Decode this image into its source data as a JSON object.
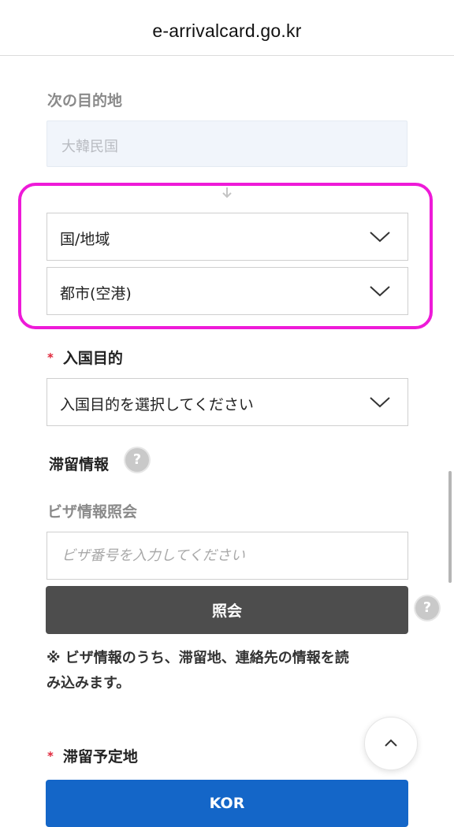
{
  "browser": {
    "url": "e-arrivalcard.go.kr"
  },
  "next_destination": {
    "label": "次の目的地",
    "value": "大韓民国"
  },
  "country_select": {
    "label": "国/地域"
  },
  "city_select": {
    "label": "都市(空港)"
  },
  "purpose": {
    "required_mark": "*",
    "label": "入国目的",
    "select_placeholder": "入国目的を選択してください"
  },
  "stay_info": {
    "title": "滞留情報",
    "help": "?"
  },
  "visa": {
    "label": "ビザ情報照会",
    "placeholder": "ビザ番号を入力してください",
    "button_label": "照会",
    "help": "?",
    "note_line1": "※ ビザ情報のうち、滞留地、連絡先の情報を読",
    "note_line2": "み込みます。"
  },
  "stay_address": {
    "required_mark": "*",
    "label": "滞留予定地",
    "button_label": "KOR"
  },
  "colors": {
    "highlight": "#ee1ad8",
    "required": "#e0263a",
    "inquiry_button": "#4d4d4d",
    "primary_button": "#1466c8"
  },
  "icons": {
    "arrow": "down-arrow-icon",
    "select": "chevron-down-icon",
    "help": "help-icon",
    "scroll_top": "chevron-up-icon"
  }
}
